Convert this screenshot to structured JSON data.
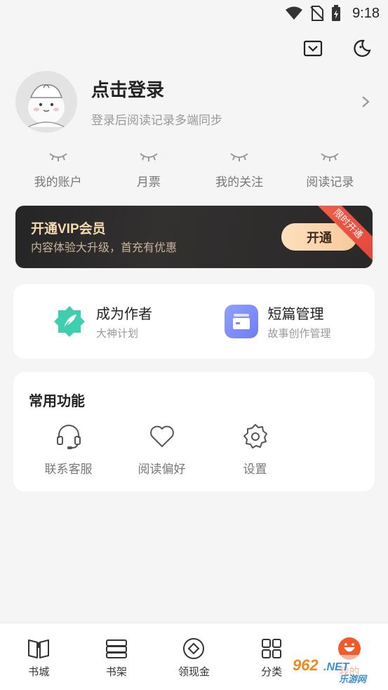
{
  "status": {
    "time": "9:18"
  },
  "header": {
    "mail_icon": "mail-icon",
    "theme_icon": "moon-icon"
  },
  "profile": {
    "title": "点击登录",
    "subtitle": "登录后阅读记录多端同步"
  },
  "quick": [
    {
      "label": "我的账户"
    },
    {
      "label": "月票"
    },
    {
      "label": "我的关注"
    },
    {
      "label": "阅读记录"
    }
  ],
  "vip": {
    "title": "开通VIP会员",
    "subtitle": "内容体验大升级，首充有优惠",
    "button": "开通",
    "ribbon": "限时开通",
    "colors": {
      "gold": "#f4d8b0",
      "ribbon": "#e4453a"
    }
  },
  "author": [
    {
      "title": "成为作者",
      "subtitle": "大神计划",
      "icon": "feather-icon"
    },
    {
      "title": "短篇管理",
      "subtitle": "故事创作管理",
      "icon": "cards-icon"
    }
  ],
  "functions": {
    "title": "常用功能",
    "items": [
      {
        "label": "联系客服",
        "icon": "headset-icon"
      },
      {
        "label": "阅读偏好",
        "icon": "heart-icon"
      },
      {
        "label": "设置",
        "icon": "gear-icon"
      }
    ]
  },
  "tabs": [
    {
      "label": "书城",
      "icon": "book-open-icon"
    },
    {
      "label": "书架",
      "icon": "bookshelf-icon"
    },
    {
      "label": "领现金",
      "icon": "coin-icon"
    },
    {
      "label": "分类",
      "icon": "grid-icon"
    },
    {
      "label": "我的",
      "icon": "smile-icon",
      "active": true
    }
  ],
  "watermark": {
    "top": "962.NET",
    "bottom": "乐游网"
  },
  "accent": "#f25a2a"
}
